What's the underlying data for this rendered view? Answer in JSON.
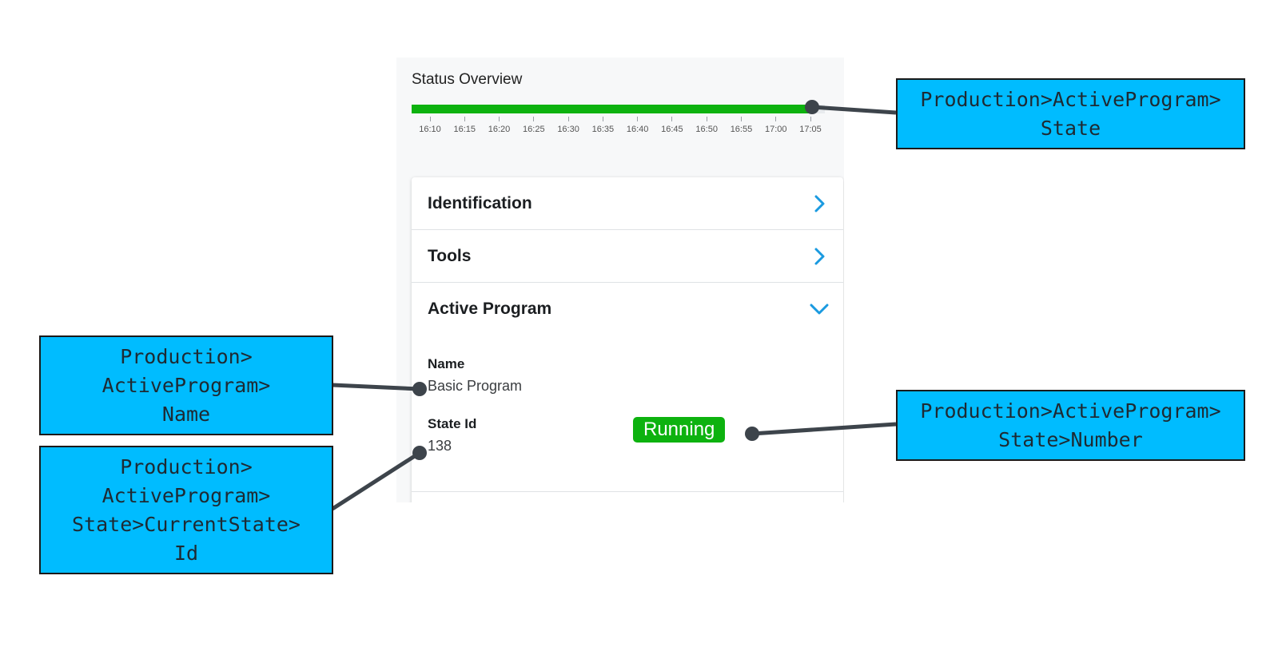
{
  "status_overview": {
    "title": "Status Overview",
    "timeline_fill_fraction": 0.975,
    "bar_color": "#0db20f",
    "ticks": [
      "16:10",
      "16:15",
      "16:20",
      "16:25",
      "16:30",
      "16:35",
      "16:40",
      "16:45",
      "16:50",
      "16:55",
      "17:00",
      "17:05"
    ]
  },
  "sections": {
    "identification": {
      "label": "Identification",
      "icon": "chevron-right-icon"
    },
    "tools": {
      "label": "Tools",
      "icon": "chevron-right-icon"
    },
    "active_program": {
      "label": "Active Program",
      "icon": "chevron-down-icon",
      "name_label": "Name",
      "name_value": "Basic Program",
      "state_id_label": "State Id",
      "state_id_value": "138",
      "state_badge": "Running",
      "badge_color": "#0db20f"
    }
  },
  "annotations": {
    "state": "Production>ActiveProgram>\nState",
    "name": "Production>\nActiveProgram>\nName",
    "state_number": "Production>ActiveProgram>\nState>Number",
    "current_state_id": "Production>\nActiveProgram>\nState>CurrentState>\nId"
  },
  "colors": {
    "accent": "#1a9ae0",
    "annotation_bg": "#00bcff",
    "connector": "#3d444b"
  }
}
